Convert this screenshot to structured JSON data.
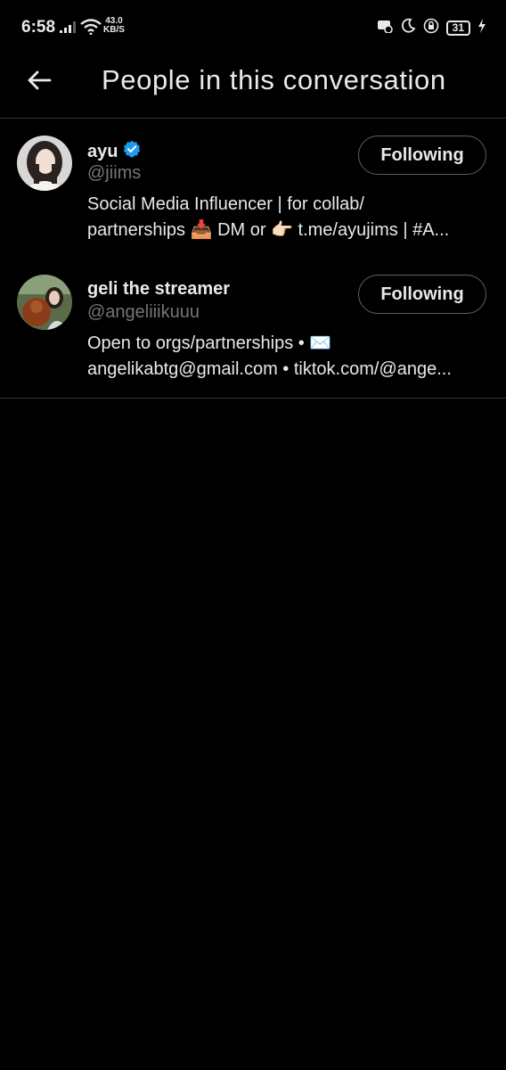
{
  "status_bar": {
    "time": "6:58",
    "net_speed_value": "43.0",
    "net_speed_unit": "KB/S",
    "battery": "31"
  },
  "header": {
    "title": "People in this conversation"
  },
  "users": [
    {
      "name": "ayu",
      "verified": true,
      "handle": "@jiims",
      "bio_line1": "Social Media Influencer | for collab/",
      "bio_line2": "partnerships 📥 DM or 👉🏻 t.me/ayujims | #A...",
      "button_label": "Following"
    },
    {
      "name": "geli the streamer",
      "verified": false,
      "handle": "@angeliiikuuu",
      "bio_line1": "Open to orgs/partnerships • ✉️",
      "bio_line2": "angelikabtg@gmail.com • tiktok.com/@ange...",
      "button_label": "Following"
    }
  ],
  "colors": {
    "background": "#000000",
    "text": "#e7e9ea",
    "secondary_text": "#71767b",
    "verified_badge": "#1d9bf0",
    "border": "#2f3336"
  }
}
